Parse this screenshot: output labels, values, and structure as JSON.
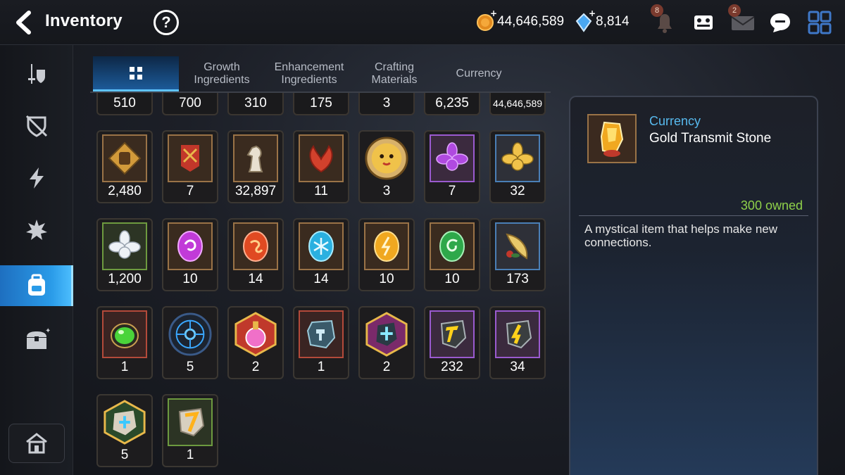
{
  "header": {
    "title": "Inventory",
    "help_label": "?",
    "gold_value": "44,646,589",
    "crystal_value": "8,814",
    "notification_badge": "8",
    "mail_badge": "2"
  },
  "tabs": [
    {
      "label": "",
      "icon": "grid-icon",
      "active": true
    },
    {
      "label": "Growth Ingredients",
      "active": false
    },
    {
      "label": "Enhancement Ingredients",
      "active": false
    },
    {
      "label": "Crafting Materials",
      "active": false
    },
    {
      "label": "Currency",
      "active": false
    }
  ],
  "top_row_counts": [
    "510",
    "700",
    "310",
    "175",
    "3",
    "6,235",
    "44,646,589"
  ],
  "rows": [
    [
      {
        "icon": "fist-emblem-icon",
        "count": "2,480"
      },
      {
        "icon": "war-banner-icon",
        "count": "7"
      },
      {
        "icon": "chess-knight-icon",
        "count": "32,897"
      },
      {
        "icon": "red-leaf-icon",
        "count": "11"
      },
      {
        "icon": "chick-token-icon",
        "count": "3"
      },
      {
        "icon": "purple-flower-icon",
        "count": "7"
      },
      {
        "icon": "gold-flower-icon",
        "count": "32"
      }
    ],
    [
      {
        "icon": "white-flower-icon",
        "count": "1,200"
      },
      {
        "icon": "purple-rune-icon",
        "count": "10"
      },
      {
        "icon": "red-rune-icon",
        "count": "14"
      },
      {
        "icon": "blue-rune-icon",
        "count": "14"
      },
      {
        "icon": "yellow-rune-icon",
        "count": "10"
      },
      {
        "icon": "green-rune-icon",
        "count": "10"
      },
      {
        "icon": "golden-fish-icon",
        "count": "173"
      }
    ],
    [
      {
        "icon": "green-orb-icon",
        "count": "1"
      },
      {
        "icon": "circuit-disc-icon",
        "count": "5"
      },
      {
        "icon": "pink-potion-icon",
        "count": "2"
      },
      {
        "icon": "hammer-stone-icon",
        "count": "1"
      },
      {
        "icon": "cross-stone-icon",
        "count": "2"
      },
      {
        "icon": "gold-transmit-stone-icon",
        "count": "232"
      },
      {
        "icon": "yellow-stone-icon",
        "count": "34"
      }
    ],
    [
      {
        "icon": "blue-cross-stone-icon",
        "count": "5"
      },
      {
        "icon": "seven-stone-icon",
        "count": "1"
      }
    ]
  ],
  "detail": {
    "category": "Currency",
    "name": "Gold Transmit Stone",
    "owned": "300 owned",
    "description": "A mystical item that helps make new connections."
  },
  "colors": {
    "accent": "#2a9be8",
    "owned_green": "#8fd14a",
    "category_blue": "#57b9ee"
  }
}
